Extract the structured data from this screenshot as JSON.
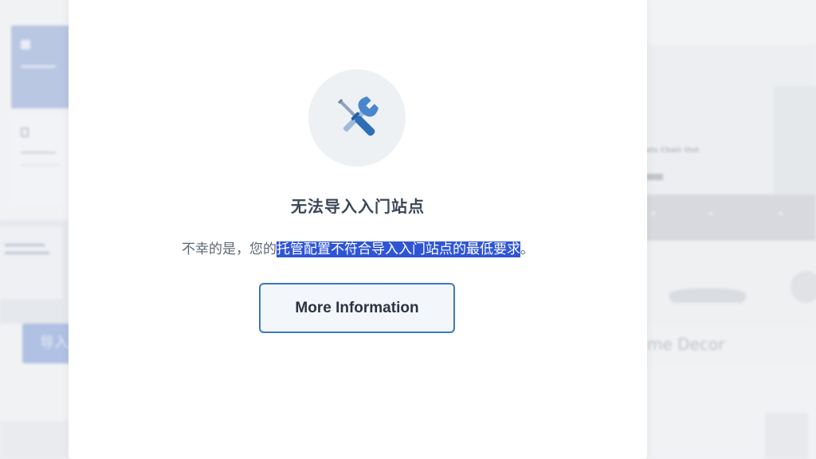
{
  "background": {
    "left_button_label": "导入",
    "right_decor_text": "me Decor",
    "right_hero_text": "ets Chair Out"
  },
  "dialog": {
    "icon": "tools-icon",
    "title": "无法导入入门站点",
    "message_prefix": "不幸的是，您的",
    "message_selected": "托管配置不符合导入入门站点的最低要求",
    "message_suffix": "。",
    "more_button_label": "More Information",
    "colors": {
      "accent_border": "#3a78c0",
      "selection": "#2f55d4",
      "icon_blue": "#2c6fb7"
    }
  }
}
